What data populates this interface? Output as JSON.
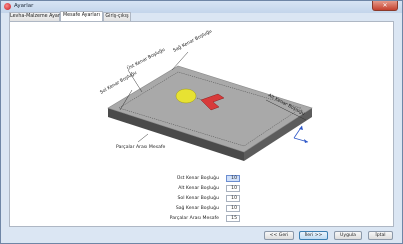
{
  "window": {
    "title": "Ayarlar",
    "close_glyph": "✕"
  },
  "tabs": [
    {
      "label": "Levha-Malzeme Ayarı",
      "active": false
    },
    {
      "label": "Mesafe Ayarları",
      "active": true
    },
    {
      "label": "Giriş-çıkış",
      "active": false
    }
  ],
  "diagram": {
    "labels": {
      "top_margin": "Üst Kenar Boşluğu",
      "right_margin": "Sağ Kenar Boşluğu",
      "left_margin": "Sol Kenar Boşluğu",
      "bottom_margin": "Alt Kenar Boşluğu",
      "part_gap": "Parçalar Arası Mesafe"
    },
    "colors": {
      "plate_top": "#a9a9a9",
      "plate_side": "#4a4a4a",
      "circle": "#e7e232",
      "l_shape": "#d83a3a",
      "axes": "#2c56c8"
    }
  },
  "form": {
    "fields": [
      {
        "label": "Üst Kenar Boşluğu",
        "value": "10",
        "focused": true
      },
      {
        "label": "Alt Kenar Boşluğu",
        "value": "10",
        "focused": false
      },
      {
        "label": "Sol Kenar Boşluğu",
        "value": "10",
        "focused": false
      },
      {
        "label": "Sağ Kenar Boşluğu",
        "value": "10",
        "focused": false
      },
      {
        "label": "Parçalar Arası Mesafe",
        "value": "15",
        "focused": false
      }
    ]
  },
  "buttons": {
    "back": "<< Geri",
    "next": "İleri >>",
    "finish": "Uygula",
    "cancel": "İptal"
  }
}
